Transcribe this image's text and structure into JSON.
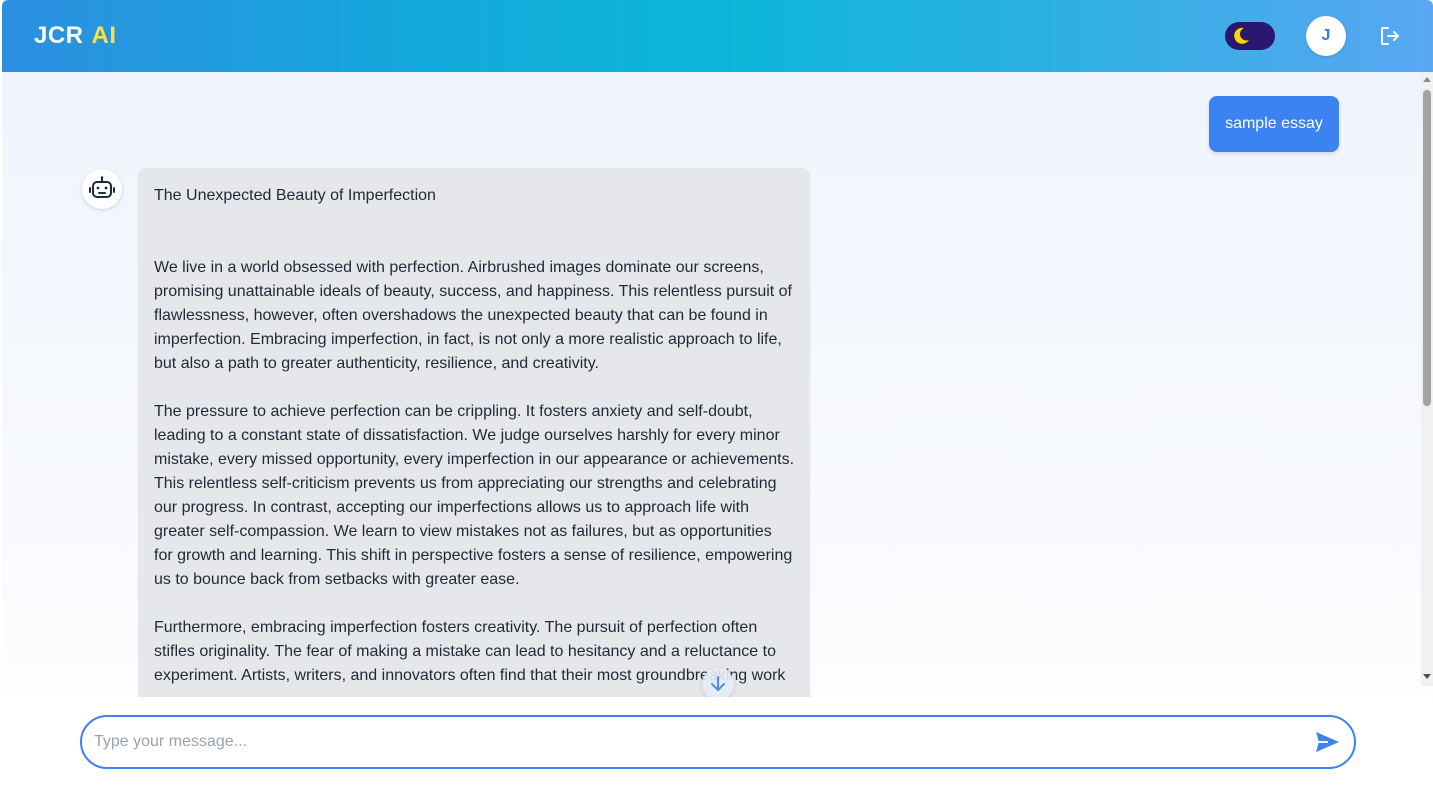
{
  "header": {
    "logo_main": "JCR",
    "logo_accent": "AI",
    "avatar_initial": "J",
    "colors": {
      "accent": "#3a83f1",
      "logo_accent": "#ffe047",
      "toggle_bg": "#2a1770"
    },
    "icons": {
      "theme": "moon-icon",
      "logout": "logout-icon"
    }
  },
  "chat": {
    "user_message": "sample essay",
    "bot": {
      "icon": "robot-icon",
      "title": "The Unexpected Beauty of Imperfection",
      "paragraphs": [
        "We live in a world obsessed with perfection. Airbrushed images dominate our screens, promising unattainable ideals of beauty, success, and happiness. This relentless pursuit of flawlessness, however, often overshadows the unexpected beauty that can be found in imperfection. Embracing imperfection, in fact, is not only a more realistic approach to life, but also a path to greater authenticity, resilience, and creativity.",
        "The pressure to achieve perfection can be crippling. It fosters anxiety and self-doubt, leading to a constant state of dissatisfaction. We judge ourselves harshly for every minor mistake, every missed opportunity, every imperfection in our appearance or achievements. This relentless self-criticism prevents us from appreciating our strengths and celebrating our progress. In contrast, accepting our imperfections allows us to approach life with greater self-compassion. We learn to view mistakes not as failures, but as opportunities for growth and learning. This shift in perspective fosters a sense of resilience, empowering us to bounce back from setbacks with greater ease.",
        "Furthermore, embracing imperfection fosters creativity. The pursuit of perfection often stifles originality. The fear of making a mistake can lead to hesitancy and a reluctance to experiment. Artists, writers, and innovators often find that their most groundbreaking work"
      ]
    },
    "scroll_down_icon": "arrow-down-icon"
  },
  "composer": {
    "placeholder": "Type your message...",
    "value": "",
    "send_icon": "send-icon"
  }
}
